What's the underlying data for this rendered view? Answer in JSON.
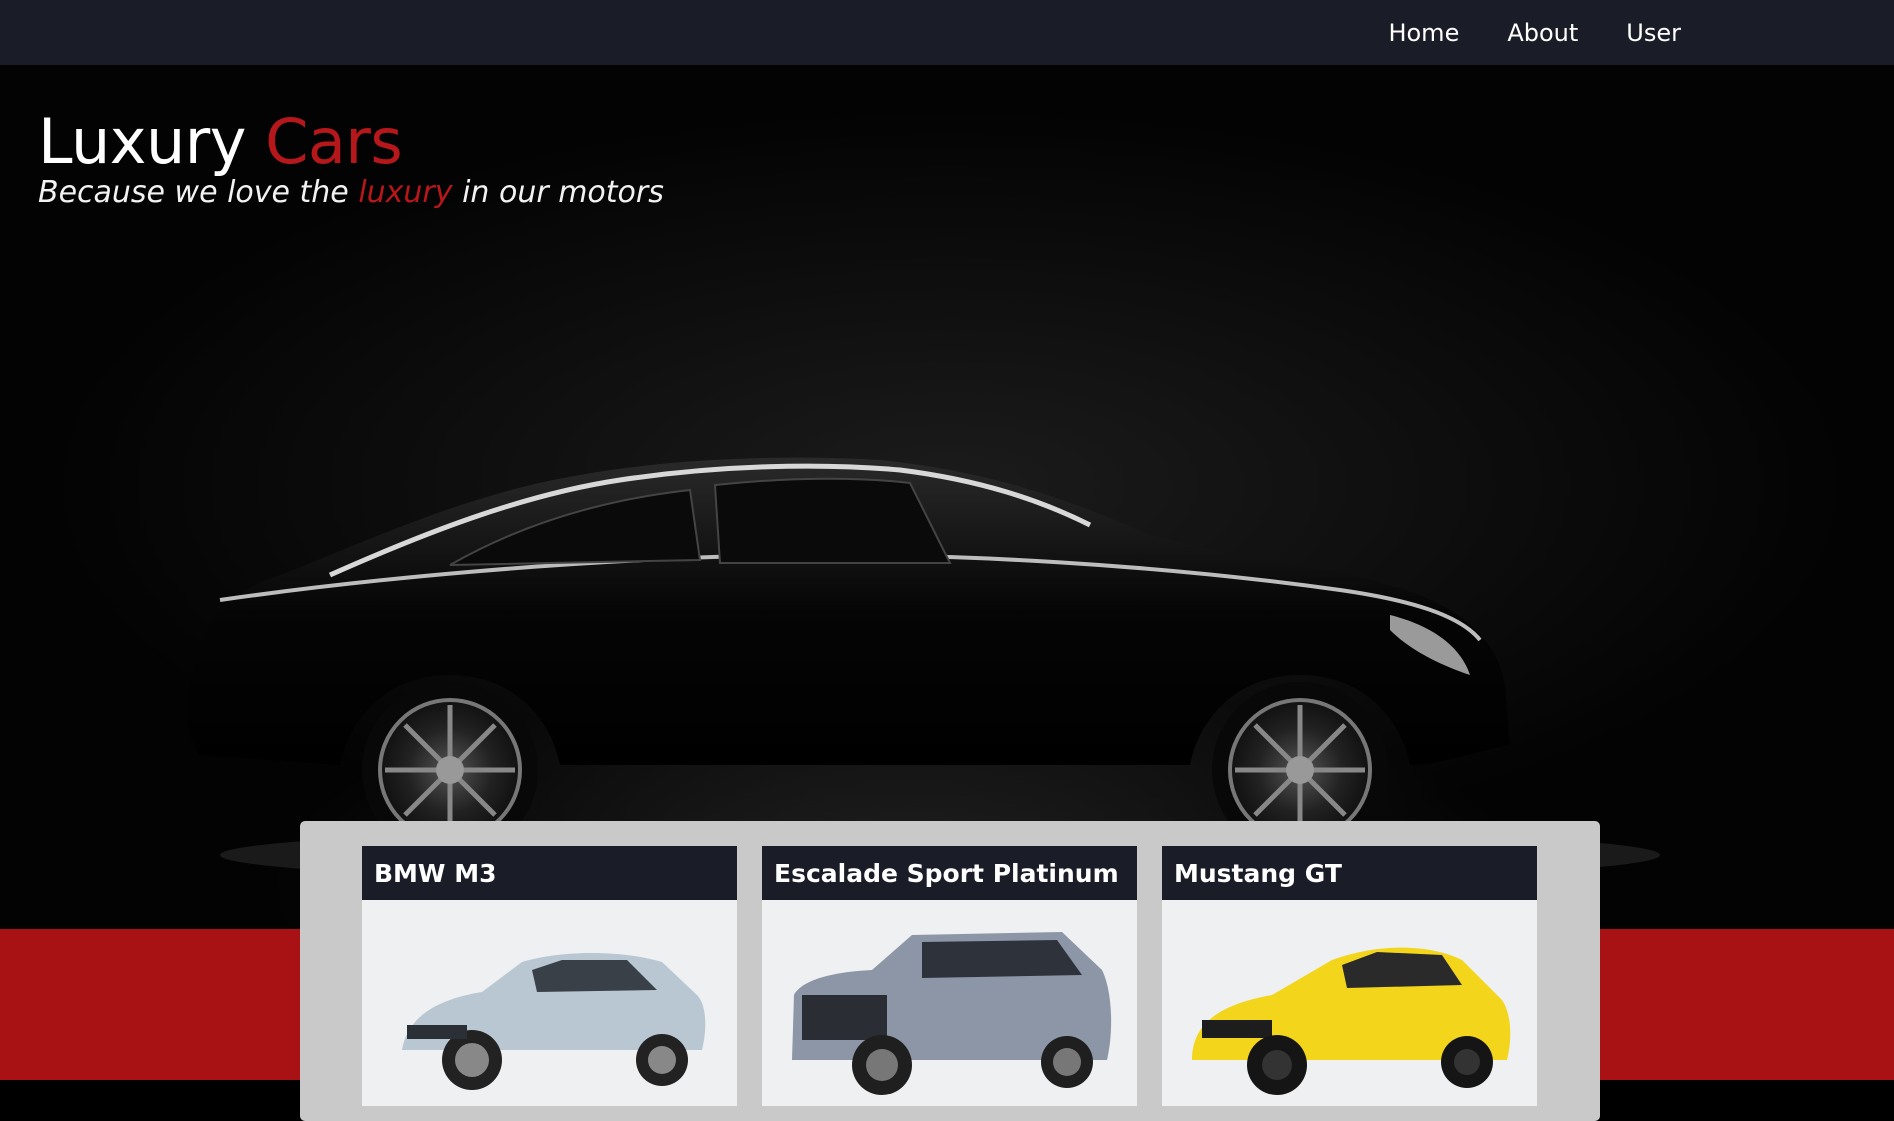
{
  "nav": {
    "links": [
      "Home",
      "About",
      "User"
    ]
  },
  "hero": {
    "title_main": "Luxury",
    "title_accent": "Cars",
    "subtitle_before": "Because we love the",
    "subtitle_accent": "luxury",
    "subtitle_after": "in our motors"
  },
  "cards": [
    {
      "title": "BMW M3",
      "car_color": "#b9c7d3",
      "image_icon": "bmw-sedan-image"
    },
    {
      "title": "Escalade Sport Platinum",
      "car_color": "#8c96a6",
      "image_icon": "suv-image"
    },
    {
      "title": "Mustang GT",
      "car_color": "#f3d61b",
      "image_icon": "coupe-image"
    }
  ],
  "colors": {
    "navbar": "#1a1d27",
    "accent_red": "#b5171a",
    "band_red": "#a91214",
    "panel_gray": "#c9c9c9"
  }
}
